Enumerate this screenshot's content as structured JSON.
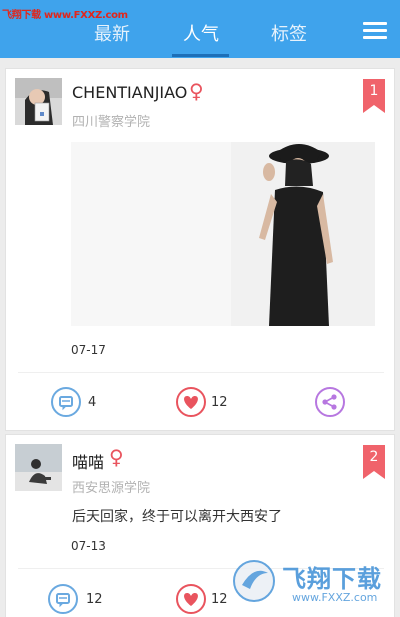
{
  "watermark": {
    "top_text": "飞翔下载 www.FXXZ.com",
    "brand_text": "飞翔下载",
    "brand_url": "www.FXXZ.com"
  },
  "header": {
    "tabs": [
      {
        "label": "最新",
        "active": false
      },
      {
        "label": "人气",
        "active": true
      },
      {
        "label": "标签",
        "active": false
      }
    ],
    "menu_icon": "hamburger-menu-icon"
  },
  "posts": [
    {
      "username": "CHENTIANJIAO",
      "gender_icon": "female-icon",
      "school": "四川警察学院",
      "rank": "1",
      "date": "07-17",
      "comments": "4",
      "likes": "12",
      "text": ""
    },
    {
      "username": "喵喵",
      "gender_icon": "female-icon",
      "school": "西安思源学院",
      "rank": "2",
      "text": "后天回家，终于可以离开大西安了",
      "date": "07-13",
      "comments": "12",
      "likes": "12"
    }
  ],
  "colors": {
    "header_bg": "#3fa3ec",
    "accent_female": "#e9545e",
    "rank_ribbon": "#f0636b",
    "comment_blue": "#6aa9e0",
    "like_red": "#e9545e",
    "share_purple": "#b777e0"
  }
}
